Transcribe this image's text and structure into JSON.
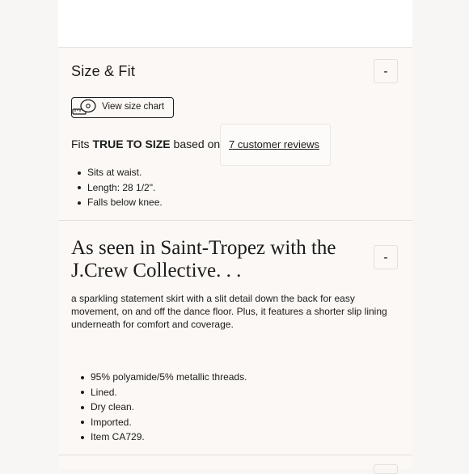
{
  "size_fit": {
    "title": "Size & Fit",
    "toggle_label": "-",
    "size_chart_label": "View size chart",
    "fit_prefix": "Fits ",
    "fit_value": "TRUE TO SIZE",
    "fit_suffix": " based on",
    "reviews_link": "7 customer reviews",
    "bullets": [
      "Sits at waist.",
      "Length: 28 1/2\".",
      "Falls below knee."
    ]
  },
  "description": {
    "title": "As seen in Saint-Tropez with the J.Crew Collective. . .",
    "toggle_label": "-",
    "body": "a sparkling statement skirt with a slit detail down the back for easy movement, on and off the dance floor. Plus, it features a shorter slip lining underneath for comfort and coverage.",
    "bullets": [
      "95% polyamide/5% metallic threads.",
      "Lined.",
      "Dry clean.",
      "Imported.",
      "Item CA729."
    ]
  },
  "icons": {
    "size_chart": "measuring-tape-icon"
  }
}
